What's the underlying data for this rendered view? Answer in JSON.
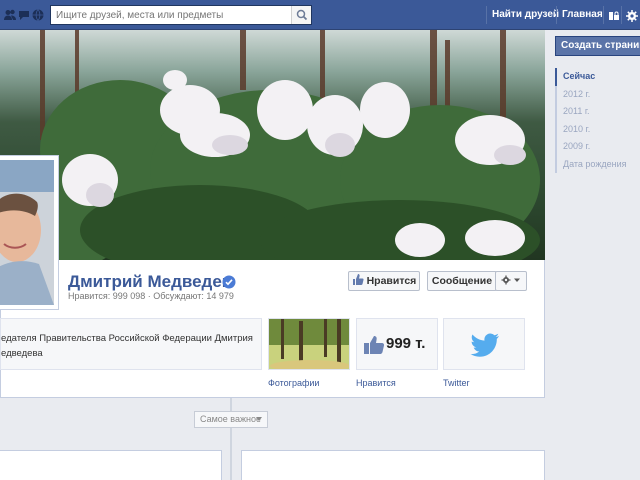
{
  "search": {
    "placeholder": "Ищите друзей, места или предметы"
  },
  "nav": {
    "find_friends": "Найти друзей",
    "home": "Главная"
  },
  "profile": {
    "name": "Дмитрий Медведев",
    "likes_stat": "Нравится: 999 098 · Обсуждают: 14 979",
    "about_line1": "едателя Правительства Российской Федерации Дмитрия",
    "about_line2": "едведева"
  },
  "buttons": {
    "like": "Нравится",
    "message": "Сообщение"
  },
  "tiles": {
    "photos": "Фотографии",
    "likes": "Нравится",
    "likes_count": "999 т.",
    "twitter": "Twitter"
  },
  "timeline": {
    "filter_label": "Самое важное"
  },
  "sidebar": {
    "create_page": "Создать страницу",
    "years": [
      "Сейчас",
      "2012 г.",
      "2011 г.",
      "2010 г.",
      "2009 г.",
      "Дата рождения"
    ]
  },
  "colors": {
    "brand": "#3b5998",
    "twitter": "#55acee"
  }
}
